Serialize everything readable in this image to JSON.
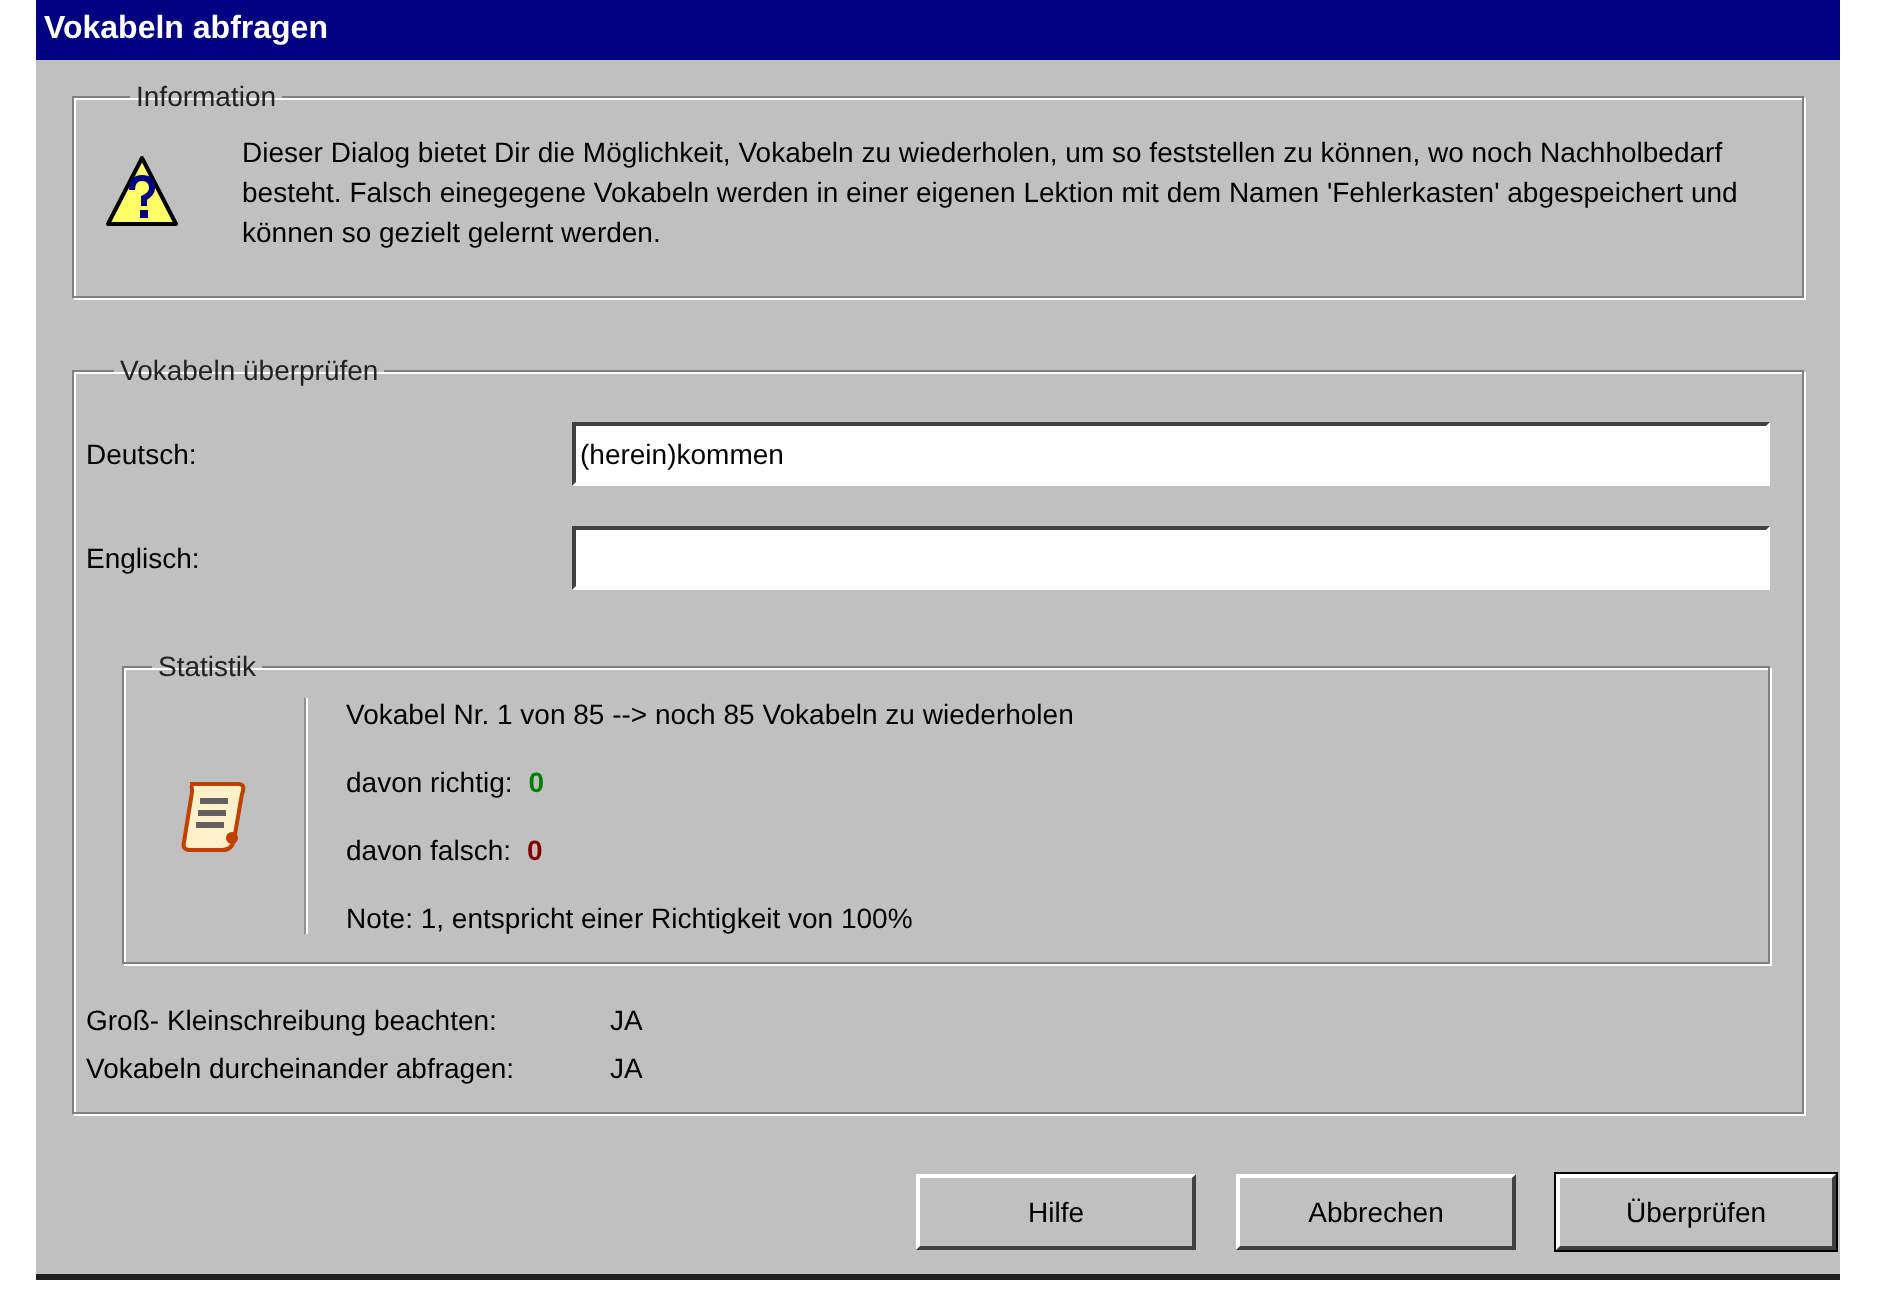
{
  "window": {
    "title": "Vokabeln abfragen"
  },
  "information": {
    "title": "Information",
    "text": "Dieser Dialog bietet Dir die Möglichkeit, Vokabeln zu wiederholen, um so feststellen zu können, wo noch Nachholbedarf besteht. Falsch einegegene Vokabeln werden in einer eigenen Lektion mit dem Namen 'Fehlerkasten' abgespeichert und können so gezielt gelernt werden."
  },
  "check": {
    "title": "Vokabeln überprüfen",
    "fields": [
      {
        "label": "Deutsch:",
        "value": "(herein)kommen"
      },
      {
        "label": "Englisch:"
      }
    ],
    "statistics": {
      "title": "Statistik",
      "progress": "Vokabel Nr. 1 von 85 --> noch 85 Vokabeln zu wiederholen",
      "counts": [
        {
          "label": "davon richtig:",
          "value": "0",
          "color": "#008000"
        },
        {
          "label": "davon falsch:",
          "value": "0",
          "color": "#800000"
        }
      ],
      "grade": "Note: 1, entspricht einer Richtigkeit von 100%"
    },
    "options": [
      {
        "label": "Groß- Kleinschreibung beachten:",
        "value": "JA"
      },
      {
        "label": "Vokabeln durcheinander abfragen:",
        "value": "JA"
      }
    ]
  },
  "buttons": [
    {
      "label": "Hilfe",
      "default": false
    },
    {
      "label": "Abbrechen",
      "default": false
    },
    {
      "label": "Überprüfen",
      "default": true
    }
  ]
}
